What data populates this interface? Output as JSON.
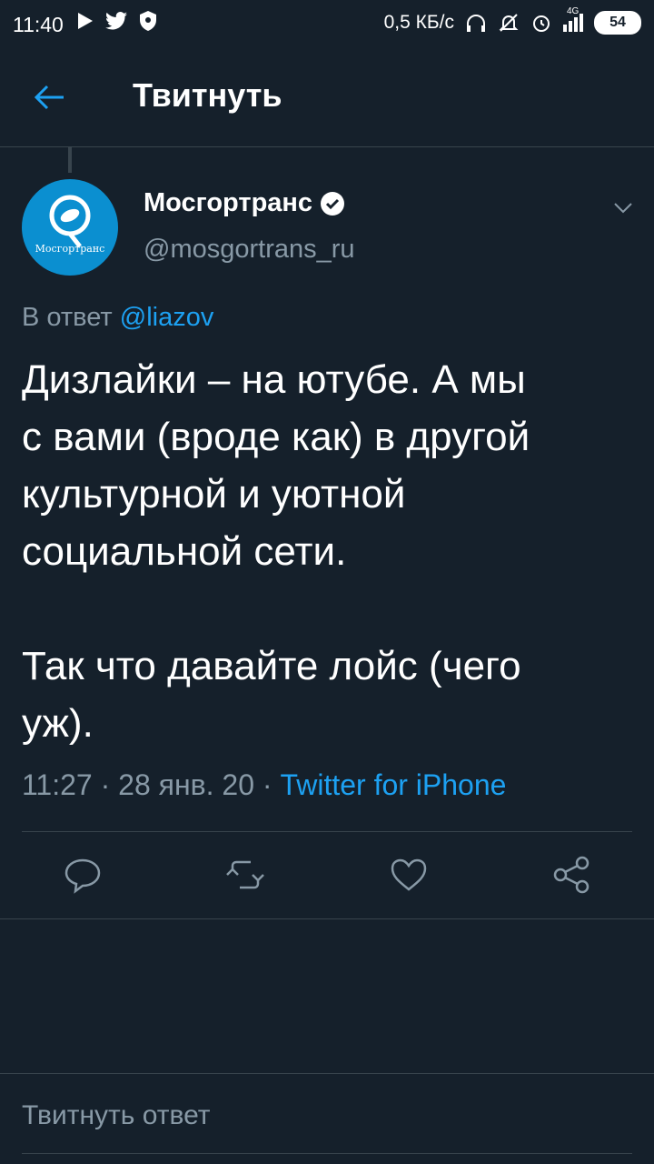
{
  "status_bar": {
    "time": "11:40",
    "network_speed": "0,5 КБ/с",
    "network_type": "4G",
    "battery": "54"
  },
  "header": {
    "title": "Твитнуть",
    "back_icon": "arrow-left-icon"
  },
  "tweet": {
    "author_name": "Мосгортранс",
    "author_handle": "@mosgortrans_ru",
    "avatar_label": "Мосгортранс",
    "verified": true,
    "reply_prefix": "В ответ ",
    "reply_mention": "@liazov",
    "text": "Дизлайки – на ютубе. А мы\nс вами (вроде как) в другой\nкультурной и уютной\nсоциальной сети.\n\nТак что давайте лойс (чего\nуж).",
    "time": "11:27",
    "date": "28 янв. 20",
    "source": "Twitter for iPhone"
  },
  "actions": [
    "reply-icon",
    "retweet-icon",
    "like-icon",
    "share-icon"
  ],
  "reply_box": {
    "placeholder": "Твитнуть ответ"
  },
  "colors": {
    "background": "#15202b",
    "accent": "#1da1f2",
    "muted": "#8899a6",
    "divider": "#38444d"
  }
}
